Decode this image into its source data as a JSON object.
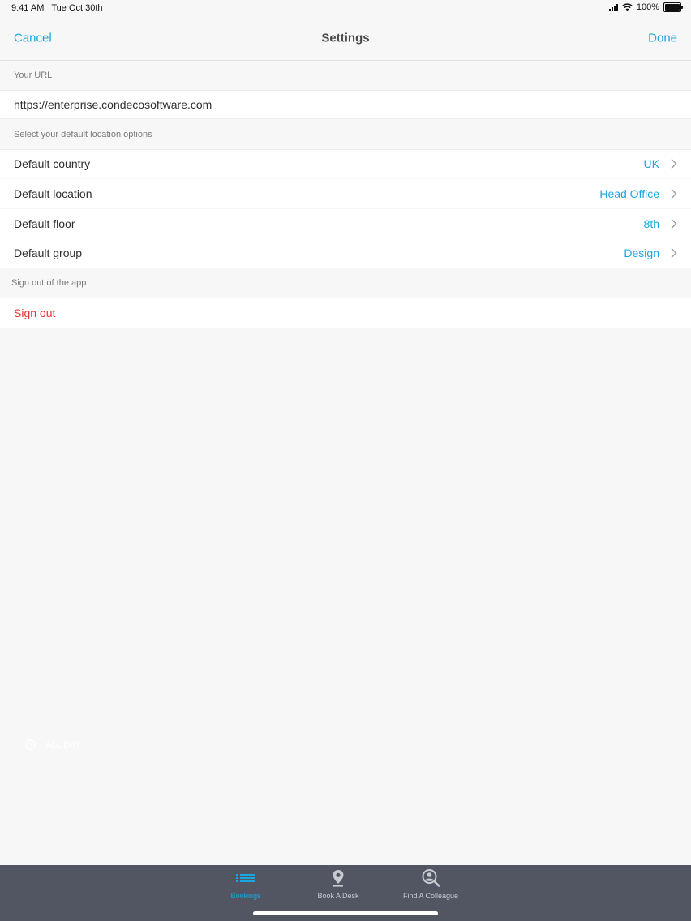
{
  "status_bar": {
    "time": "9:41 AM",
    "date": "Tue Oct 30th",
    "battery": "100%",
    "battery_level": 1.0
  },
  "nav": {
    "cancel_label": "Cancel",
    "title": "Settings",
    "done_label": "Done"
  },
  "url_section": {
    "header": "Your URL",
    "value": "https://enterprise.condecosoftware.com"
  },
  "location_section": {
    "header": "Select your default location options",
    "rows": [
      {
        "label": "Default country",
        "value": "UK"
      },
      {
        "label": "Default location",
        "value": "Head Office"
      },
      {
        "label": "Default floor",
        "value": "8th"
      },
      {
        "label": "Default group",
        "value": "Design"
      }
    ]
  },
  "signout_section": {
    "header": "Sign out of the app",
    "button_label": "Sign out"
  },
  "ghost": {
    "allday_label": "ALL DAY"
  },
  "tab_bar": {
    "tabs": [
      {
        "label": "Bookings",
        "icon": "list-icon",
        "active": true
      },
      {
        "label": "Book A Desk",
        "icon": "location-pin-icon",
        "active": false
      },
      {
        "label": "Find A Colleague",
        "icon": "person-search-icon",
        "active": false
      }
    ]
  },
  "colors": {
    "accent": "#1aa7e0",
    "destructive": "#e5322d",
    "tab_bar_bg": "#525663",
    "background": "#f7f7f7"
  }
}
